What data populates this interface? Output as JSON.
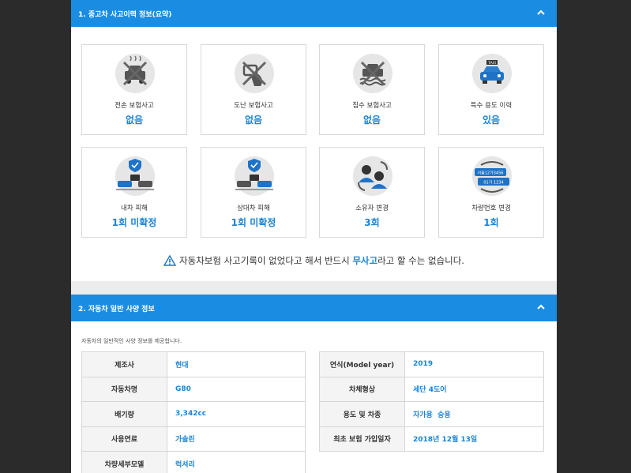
{
  "section1": {
    "title": "1. 중고차 사고이력 정보(요약)",
    "cards": [
      {
        "label": "전손 보험사고",
        "value": "없음",
        "icon": "total-loss-icon"
      },
      {
        "label": "도난 보험사고",
        "value": "없음",
        "icon": "theft-icon"
      },
      {
        "label": "침수 보험사고",
        "value": "없음",
        "icon": "flood-icon"
      },
      {
        "label": "특수 용도 이력",
        "value": "있음",
        "icon": "taxi-icon"
      },
      {
        "label": "내차 피해",
        "value": "1회 미확정",
        "icon": "own-damage-icon"
      },
      {
        "label": "상대차 피해",
        "value": "1회 미확정",
        "icon": "other-damage-icon"
      },
      {
        "label": "소유자 변경",
        "value": "3회",
        "icon": "owner-change-icon"
      },
      {
        "label": "차량번호 변경",
        "value": "1회",
        "icon": "plate-change-icon"
      }
    ],
    "notice": {
      "before": "자동차보험 사고기록이 없었다고 해서 반드시 ",
      "highlight": "무사고",
      "after": "라고 할 수는 없습니다."
    }
  },
  "section2": {
    "title": "2. 자동차 일반 사양 정보",
    "description": "자동차의 일반적인 사양 정보를 제공합니다.",
    "left": [
      {
        "key": "제조사",
        "value": "현대"
      },
      {
        "key": "자동차명",
        "value": "G80"
      },
      {
        "key": "배기량",
        "value": "3,342cc"
      },
      {
        "key": "사용연료",
        "value": "가솔린"
      },
      {
        "key": "차량세부모델",
        "value": "럭셔리"
      }
    ],
    "right": [
      {
        "key": "연식(Model year)",
        "value": "2019"
      },
      {
        "key": "차체형상",
        "value": "세단 4도어"
      },
      {
        "key": "용도 및 차종",
        "value": "자가용  승용"
      },
      {
        "key": "최초 보험 가입일자",
        "value": "2018년 12월 13일"
      }
    ]
  },
  "colors": {
    "accent": "#1a8de3",
    "value_text": "#1a84d6",
    "backdrop": "#2b2b2b"
  }
}
